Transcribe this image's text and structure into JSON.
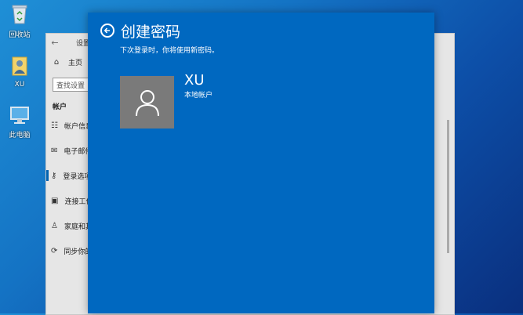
{
  "desktop": {
    "icons": [
      {
        "label": "回收站",
        "icon": "recycle-bin-icon"
      },
      {
        "label": "XU",
        "icon": "user-folder-icon"
      },
      {
        "label": "此电脑",
        "icon": "computer-icon"
      }
    ]
  },
  "settings_window": {
    "title": "设置",
    "sidebar": {
      "home_label": "主页",
      "search_placeholder": "查找设置",
      "section_title": "帐户",
      "items": [
        {
          "label": "帐户信息",
          "icon": "person-card-icon"
        },
        {
          "label": "电子邮件",
          "icon": "mail-icon"
        },
        {
          "label": "登录选项",
          "icon": "key-icon"
        },
        {
          "label": "连接工作",
          "icon": "briefcase-icon"
        },
        {
          "label": "家庭和其他",
          "icon": "person-add-icon"
        },
        {
          "label": "同步你的设置",
          "icon": "sync-icon"
        }
      ]
    }
  },
  "dialog": {
    "title": "创建密码",
    "subtitle": "下次登录时，你将使用新密码。",
    "user": {
      "name": "XU",
      "type": "本地帐户"
    },
    "colors": {
      "background": "#0068c0",
      "avatar_bg": "#7a7a7a"
    }
  }
}
